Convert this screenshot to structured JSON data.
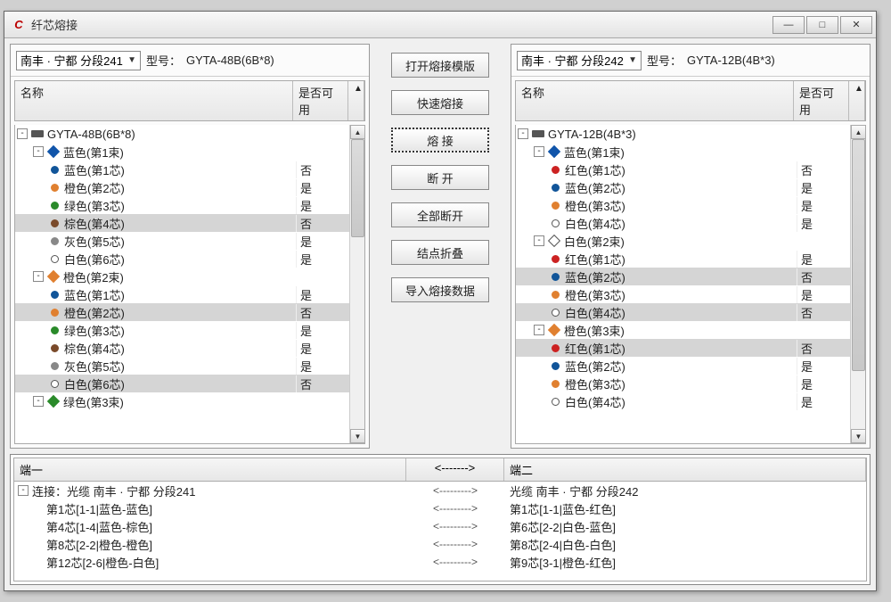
{
  "window": {
    "title": "纤芯熔接"
  },
  "left": {
    "selectValue": "南丰 · 宁都 分段241",
    "modelLabel": "型号：",
    "modelValue": "GYTA-48B(6B*8)",
    "cols": {
      "name": "名称",
      "avail": "是否可用"
    },
    "rows": [
      {
        "indent": 0,
        "twisty": "-",
        "icon": "cable",
        "label": "GYTA-48B(6B*8)",
        "avail": "",
        "hl": false
      },
      {
        "indent": 1,
        "twisty": "-",
        "icon": "group",
        "color": "#15a",
        "label": "蓝色(第1束)",
        "avail": "",
        "hl": false
      },
      {
        "indent": 2,
        "icon": "core",
        "color": "#115599",
        "label": "蓝色(第1芯)",
        "avail": "否",
        "hl": false
      },
      {
        "indent": 2,
        "icon": "core",
        "color": "#e08030",
        "label": "橙色(第2芯)",
        "avail": "是",
        "hl": false
      },
      {
        "indent": 2,
        "icon": "core",
        "color": "#2a8a2a",
        "label": "绿色(第3芯)",
        "avail": "是",
        "hl": false
      },
      {
        "indent": 2,
        "icon": "core",
        "color": "#7a4a2a",
        "label": "棕色(第4芯)",
        "avail": "否",
        "hl": true
      },
      {
        "indent": 2,
        "icon": "core",
        "color": "#888",
        "label": "灰色(第5芯)",
        "avail": "是",
        "hl": false
      },
      {
        "indent": 2,
        "icon": "core",
        "color": "#fff",
        "ring": true,
        "label": "白色(第6芯)",
        "avail": "是",
        "hl": false
      },
      {
        "indent": 1,
        "twisty": "-",
        "icon": "group",
        "color": "#e08030",
        "label": "橙色(第2束)",
        "avail": "",
        "hl": false
      },
      {
        "indent": 2,
        "icon": "core",
        "color": "#115599",
        "label": "蓝色(第1芯)",
        "avail": "是",
        "hl": false
      },
      {
        "indent": 2,
        "icon": "core",
        "color": "#e08030",
        "label": "橙色(第2芯)",
        "avail": "否",
        "hl": true
      },
      {
        "indent": 2,
        "icon": "core",
        "color": "#2a8a2a",
        "label": "绿色(第3芯)",
        "avail": "是",
        "hl": false
      },
      {
        "indent": 2,
        "icon": "core",
        "color": "#7a4a2a",
        "label": "棕色(第4芯)",
        "avail": "是",
        "hl": false
      },
      {
        "indent": 2,
        "icon": "core",
        "color": "#888",
        "label": "灰色(第5芯)",
        "avail": "是",
        "hl": false
      },
      {
        "indent": 2,
        "icon": "core",
        "color": "#fff",
        "ring": true,
        "label": "白色(第6芯)",
        "avail": "否",
        "hl": true
      },
      {
        "indent": 1,
        "twisty": "-",
        "icon": "group",
        "color": "#2a8a2a",
        "label": "绿色(第3束)",
        "avail": "",
        "hl": false
      }
    ]
  },
  "right": {
    "selectValue": "南丰 · 宁都 分段242",
    "modelLabel": "型号：",
    "modelValue": "GYTA-12B(4B*3)",
    "cols": {
      "name": "名称",
      "avail": "是否可用"
    },
    "rows": [
      {
        "indent": 0,
        "twisty": "-",
        "icon": "cable",
        "label": "GYTA-12B(4B*3)",
        "avail": "",
        "hl": false
      },
      {
        "indent": 1,
        "twisty": "-",
        "icon": "group",
        "color": "#15a",
        "label": "蓝色(第1束)",
        "avail": "",
        "hl": false
      },
      {
        "indent": 2,
        "icon": "core",
        "color": "#c22",
        "label": "红色(第1芯)",
        "avail": "否",
        "hl": false
      },
      {
        "indent": 2,
        "icon": "core",
        "color": "#115599",
        "label": "蓝色(第2芯)",
        "avail": "是",
        "hl": false
      },
      {
        "indent": 2,
        "icon": "core",
        "color": "#e08030",
        "label": "橙色(第3芯)",
        "avail": "是",
        "hl": false
      },
      {
        "indent": 2,
        "icon": "core",
        "color": "#fff",
        "ring": true,
        "label": "白色(第4芯)",
        "avail": "是",
        "hl": false
      },
      {
        "indent": 1,
        "twisty": "-",
        "icon": "group",
        "color": "#fff",
        "ring": true,
        "label": "白色(第2束)",
        "avail": "",
        "hl": false
      },
      {
        "indent": 2,
        "icon": "core",
        "color": "#c22",
        "label": "红色(第1芯)",
        "avail": "是",
        "hl": false
      },
      {
        "indent": 2,
        "icon": "core",
        "color": "#115599",
        "label": "蓝色(第2芯)",
        "avail": "否",
        "hl": true
      },
      {
        "indent": 2,
        "icon": "core",
        "color": "#e08030",
        "label": "橙色(第3芯)",
        "avail": "是",
        "hl": false
      },
      {
        "indent": 2,
        "icon": "core",
        "color": "#fff",
        "ring": true,
        "label": "白色(第4芯)",
        "avail": "否",
        "hl": true
      },
      {
        "indent": 1,
        "twisty": "-",
        "icon": "group",
        "color": "#e08030",
        "label": "橙色(第3束)",
        "avail": "",
        "hl": false
      },
      {
        "indent": 2,
        "icon": "core",
        "color": "#c22",
        "label": "红色(第1芯)",
        "avail": "否",
        "hl": true
      },
      {
        "indent": 2,
        "icon": "core",
        "color": "#115599",
        "label": "蓝色(第2芯)",
        "avail": "是",
        "hl": false
      },
      {
        "indent": 2,
        "icon": "core",
        "color": "#e08030",
        "label": "橙色(第3芯)",
        "avail": "是",
        "hl": false
      },
      {
        "indent": 2,
        "icon": "core",
        "color": "#fff",
        "ring": true,
        "label": "白色(第4芯)",
        "avail": "是",
        "hl": false
      }
    ]
  },
  "buttons": {
    "open_template": "打开熔接模版",
    "quick_splice": "快速熔接",
    "splice": "熔 接",
    "disconnect": "断 开",
    "disconnect_all": "全部断开",
    "collapse": "结点折叠",
    "import": "导入熔接数据"
  },
  "bottom": {
    "cols": {
      "end1": "端一",
      "arrow": "<------->",
      "end2": "端二"
    },
    "rows": [
      {
        "twisty": "-",
        "c1": "连接：光缆 南丰 · 宁都 分段241",
        "arr": "<--------->",
        "c2": "光缆 南丰 · 宁都 分段242"
      },
      {
        "c1": "第1芯[1-1|蓝色-蓝色]",
        "arr": "<--------->",
        "c2": "第1芯[1-1|蓝色-红色]"
      },
      {
        "c1": "第4芯[1-4|蓝色-棕色]",
        "arr": "<--------->",
        "c2": "第6芯[2-2|白色-蓝色]"
      },
      {
        "c1": "第8芯[2-2|橙色-橙色]",
        "arr": "<--------->",
        "c2": "第8芯[2-4|白色-白色]"
      },
      {
        "c1": "第12芯[2-6|橙色-白色]",
        "arr": "<--------->",
        "c2": "第9芯[3-1|橙色-红色]"
      }
    ]
  }
}
